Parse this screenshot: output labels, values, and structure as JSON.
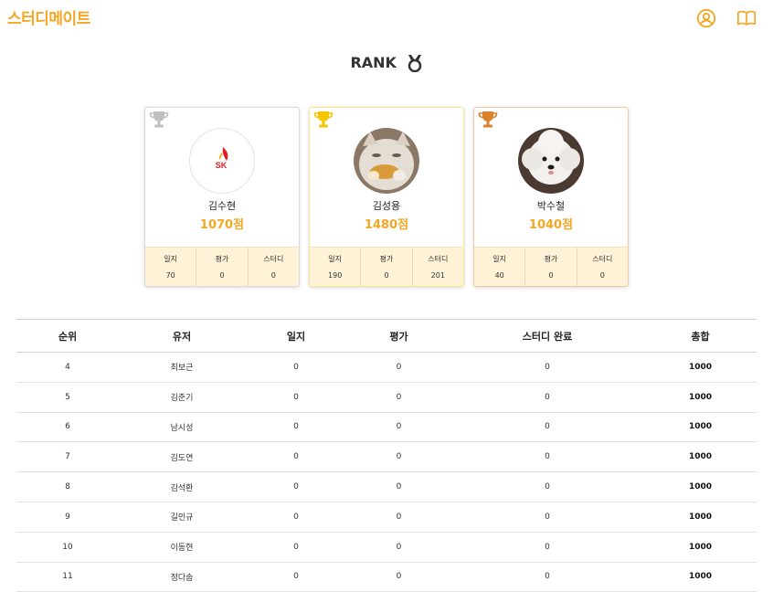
{
  "header": {
    "logo": "스터디메이트",
    "icons": [
      "user-circle-icon",
      "book-icon"
    ]
  },
  "rank": {
    "title": "RANK",
    "icon": "medal-icon"
  },
  "podium": [
    {
      "place": "silver",
      "trophy_color": "#c0c0c0",
      "avatar": "sk-logo",
      "name": "김수현",
      "score": "1070점",
      "stats": [
        {
          "label": "일지",
          "value": "70"
        },
        {
          "label": "평가",
          "value": "0"
        },
        {
          "label": "스터디",
          "value": "0"
        }
      ]
    },
    {
      "place": "gold",
      "trophy_color": "#f7c600",
      "avatar": "cat-photo",
      "name": "김성용",
      "score": "1480점",
      "stats": [
        {
          "label": "일지",
          "value": "190"
        },
        {
          "label": "평가",
          "value": "0"
        },
        {
          "label": "스터디",
          "value": "201"
        }
      ]
    },
    {
      "place": "bronze",
      "trophy_color": "#d9822b",
      "avatar": "dog-photo",
      "name": "박수철",
      "score": "1040점",
      "stats": [
        {
          "label": "일지",
          "value": "40"
        },
        {
          "label": "평가",
          "value": "0"
        },
        {
          "label": "스터디",
          "value": "0"
        }
      ]
    }
  ],
  "table": {
    "headers": [
      "순위",
      "유저",
      "일지",
      "평가",
      "스터디 완료",
      "총합"
    ],
    "rows": [
      [
        "4",
        "최보근",
        "0",
        "0",
        "0",
        "1000"
      ],
      [
        "5",
        "김준기",
        "0",
        "0",
        "0",
        "1000"
      ],
      [
        "6",
        "남시성",
        "0",
        "0",
        "0",
        "1000"
      ],
      [
        "7",
        "김도연",
        "0",
        "0",
        "0",
        "1000"
      ],
      [
        "8",
        "김석환",
        "0",
        "0",
        "0",
        "1000"
      ],
      [
        "9",
        "길민규",
        "0",
        "0",
        "0",
        "1000"
      ],
      [
        "10",
        "이동현",
        "0",
        "0",
        "0",
        "1000"
      ],
      [
        "11",
        "정다솜",
        "0",
        "0",
        "0",
        "1000"
      ]
    ]
  },
  "colors": {
    "accent": "#f5a623",
    "stats_bg": "#fff2d6"
  }
}
